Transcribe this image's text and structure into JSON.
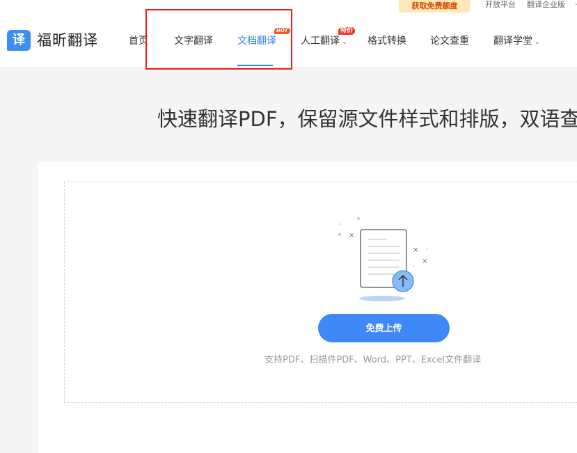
{
  "topbar": {
    "promo_label": "获取免费额度",
    "links": [
      "开放平台",
      "翻译企业版",
      "·"
    ]
  },
  "brand": {
    "logo_glyph": "译",
    "name": "福昕翻译",
    "color": "#3d8ef0"
  },
  "nav": {
    "items": [
      {
        "label": "首页"
      },
      {
        "label": "文字翻译"
      },
      {
        "label": "文档翻译",
        "active": true,
        "badge": "HOT"
      },
      {
        "label": "人工翻译",
        "badge": "特价",
        "dropdown": true
      },
      {
        "label": "格式转换"
      },
      {
        "label": "论文查重"
      },
      {
        "label": "翻译学堂",
        "dropdown": true
      }
    ],
    "accent": "#2f7ff0",
    "highlight_color": "#ee1c1c"
  },
  "main": {
    "headline": "快速翻译PDF，保留源文件样式和排版，双语查",
    "upload_button": "免费上传",
    "support_text": "支持PDF、扫描件PDF、Word、PPT、Excel文件翻译",
    "button_color": "#3e89f7"
  }
}
